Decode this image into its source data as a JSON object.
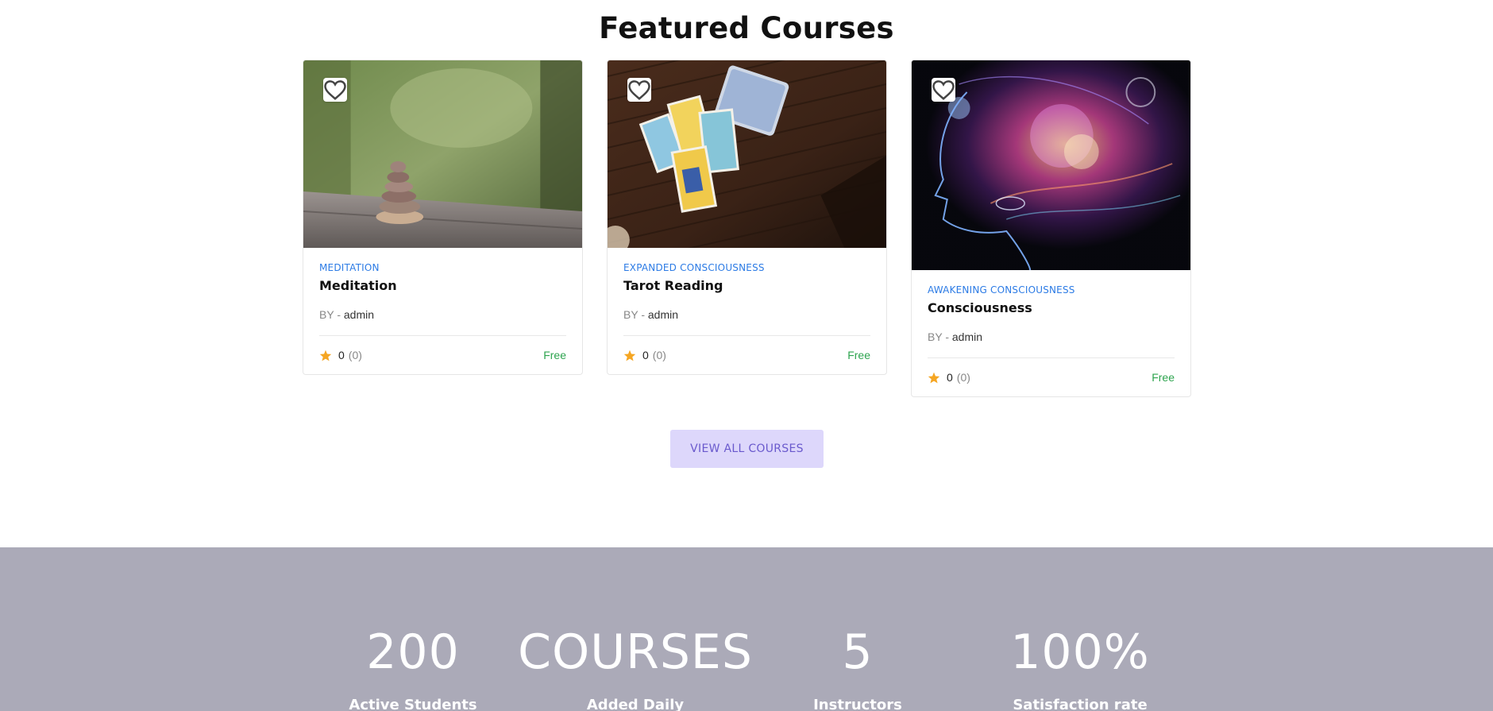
{
  "section": {
    "title": "Featured Courses"
  },
  "courses": [
    {
      "category": "MEDITATION",
      "title": "Meditation",
      "by_label": "BY -",
      "author": "admin",
      "rating": "0",
      "rating_count": "(0)",
      "price": "Free"
    },
    {
      "category": "EXPANDED CONSCIOUSNESS",
      "title": "Tarot Reading",
      "by_label": "BY -",
      "author": "admin",
      "rating": "0",
      "rating_count": "(0)",
      "price": "Free"
    },
    {
      "category": "AWAKENING CONSCIOUSNESS",
      "title": "Consciousness",
      "by_label": "BY -",
      "author": "admin",
      "rating": "0",
      "rating_count": "(0)",
      "price": "Free"
    }
  ],
  "cta": {
    "label": "VIEW ALL COURSES"
  },
  "stats": [
    {
      "value": "200",
      "label": "Active Students"
    },
    {
      "value": "COURSES",
      "label": "Added Daily"
    },
    {
      "value": "5",
      "label": "Instructors"
    },
    {
      "value": "100%",
      "label": "Satisfaction rate"
    }
  ],
  "colors": {
    "category": "#2c7be5",
    "price": "#2ea44f",
    "star": "#f5a623",
    "cta_bg": "#ddd7fb",
    "cta_text": "#6a5acd",
    "stats_bg": "#abaab8"
  },
  "icons": {
    "wishlist": "heart-outline-icon",
    "rating": "star-icon"
  }
}
